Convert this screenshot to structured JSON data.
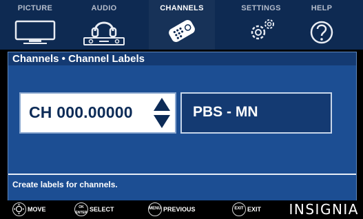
{
  "menu": {
    "tabs": [
      {
        "label": "PICTURE",
        "icon": "tv-icon",
        "active": false
      },
      {
        "label": "AUDIO",
        "icon": "headphones-speaker-icon",
        "active": false
      },
      {
        "label": "CHANNELS",
        "icon": "remote-control-icon",
        "active": true
      },
      {
        "label": "SETTINGS",
        "icon": "gears-icon",
        "active": false
      },
      {
        "label": "HELP",
        "icon": "question-icon",
        "active": false
      }
    ]
  },
  "panel": {
    "breadcrumb": "Channels • Channel Labels",
    "channel_value": "CH  000.00000",
    "channel_label": "PBS - MN",
    "hint": "Create labels for channels."
  },
  "footer": {
    "move": {
      "button": "",
      "label": "MOVE"
    },
    "select": {
      "button": "OK ENTER",
      "label": "SELECT"
    },
    "previous": {
      "button": "MENU",
      "label": "PREVIOUS"
    },
    "exit": {
      "button": "EXIT",
      "label": "EXIT"
    },
    "brand": "INSIGNIA"
  },
  "colors": {
    "menu_bg": "#0e2a52",
    "panel_bg": "#1c4e93",
    "crumb_bg": "#143a72",
    "accent_text": "#0c2b57"
  }
}
